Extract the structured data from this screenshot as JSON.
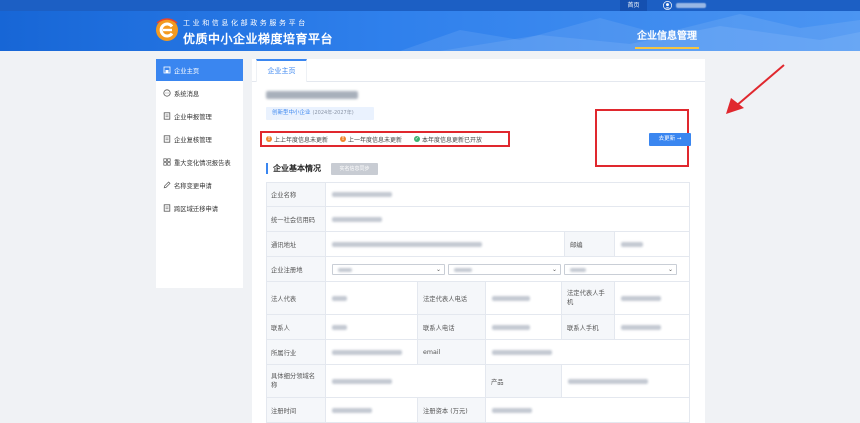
{
  "header": {
    "top_nav": {
      "home_label": "首页"
    },
    "brand_subtitle": "工业和信息化部政务服务平台",
    "brand_title": "优质中小企业梯度培育平台",
    "module_tab": "企业信息管理"
  },
  "sidebar": {
    "items": [
      {
        "label": "企业主页",
        "icon": "home-icon",
        "active": true
      },
      {
        "label": "系统消息",
        "icon": "chat-icon"
      },
      {
        "label": "企业申报管理",
        "icon": "document-icon"
      },
      {
        "label": "企业复核管理",
        "icon": "document-icon"
      },
      {
        "label": "重大变化情况报告表",
        "icon": "grid-icon"
      },
      {
        "label": "名称变更申请",
        "icon": "edit-icon"
      },
      {
        "label": "跨区域迁移申请",
        "icon": "document-icon"
      }
    ]
  },
  "main": {
    "tab_label": "企业主页",
    "qualification": {
      "label": "创新型中小企业",
      "period": "(2024年-2027年)"
    },
    "notices": [
      {
        "text": "上上年度信息未更新",
        "status": "warn"
      },
      {
        "text": "上一年度信息未更新",
        "status": "warn"
      },
      {
        "text": "本年度信息更新已开放",
        "status": "ok"
      }
    ],
    "update_button": "去更新 →",
    "section_title": "企业基本情况",
    "sync_button": "实名信息同步",
    "form": {
      "company_name": "企业名称",
      "credit_code": "统一社会信用码",
      "address": "通讯地址",
      "postcode": "邮编",
      "registered_location": "企业注册地",
      "legal_rep": "法人代表",
      "legal_rep_phone": "法定代表人电话",
      "legal_rep_mobile": "法定代表人手机",
      "contact": "联系人",
      "contact_phone": "联系人电话",
      "contact_mobile": "联系人手机",
      "industry": "所属行业",
      "email": "email",
      "segment_name": "具体细分领域名称",
      "product": "产品",
      "reg_date": "注册时间",
      "reg_capital": "注册资本 (万元)"
    }
  },
  "colors": {
    "primary": "#3a86f0",
    "header": "#1766d6",
    "alert": "#e0282e",
    "warn": "#f0862e",
    "ok": "#3cb371"
  }
}
